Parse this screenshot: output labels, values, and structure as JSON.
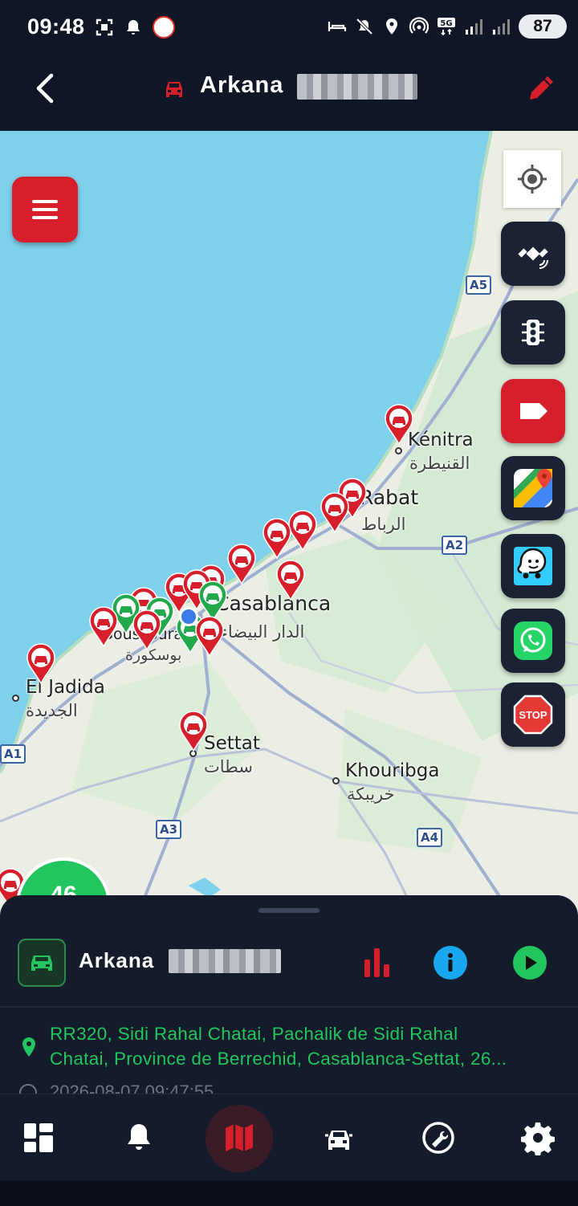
{
  "status_bar": {
    "time": "09:48",
    "battery": "87",
    "left_icons": [
      "screenshot-icon",
      "notification-bell-icon",
      "app-badge-icon"
    ],
    "right_icons": [
      "bed-icon",
      "mute-icon",
      "location-icon",
      "hotspot-icon",
      "5g-icon",
      "signal-icon",
      "signal-icon",
      "battery-icon"
    ]
  },
  "header": {
    "title": "Arkana",
    "back_icon": "chevron-left-icon",
    "vehicle_icon": "car-icon",
    "edit_icon": "pencil-icon",
    "accent": "#d71f2b"
  },
  "map": {
    "labels": {
      "kenitra": "Kénitra",
      "kenitra_ar": "القنيطرة",
      "rabat": "Rabat",
      "rabat_ar": "الرباط",
      "casablanca": "Casablanca",
      "casablanca_ar": "الدار البيضاء",
      "bouskoura": "Bouskoura",
      "bouskoura_ar": "بوسكورة",
      "el_jadida": "El Jadida",
      "el_jadida_ar": "الجديدة",
      "settat": "Settat",
      "settat_ar": "سطات",
      "khouribga": "Khouribga",
      "khouribga_ar": "خريبكة"
    },
    "roads": [
      "A5",
      "A2",
      "A1",
      "A3",
      "A4"
    ],
    "cluster_count": "46",
    "side_buttons": [
      "satellite-icon",
      "traffic-light-icon",
      "label-icon",
      "google-maps-icon",
      "waze-icon",
      "whatsapp-icon",
      "stop-sign-icon"
    ],
    "stop_text": "STOP"
  },
  "vehicle_panel": {
    "name": "Arkana",
    "address_line1": "RR320, Sidi Rahal Chatai, Pachalik de Sidi Rahal",
    "address_line2": "Chatai, Province de Berrechid, Casablanca-Settat, 26...",
    "timestamp": "2026-08-07 09:47:55",
    "status_color": "#22c55e"
  },
  "bottom_nav": {
    "items": [
      "dashboard-icon",
      "bell-icon",
      "map-icon",
      "vehicle-icon",
      "tools-icon",
      "settings-icon"
    ],
    "active": "map-icon"
  }
}
